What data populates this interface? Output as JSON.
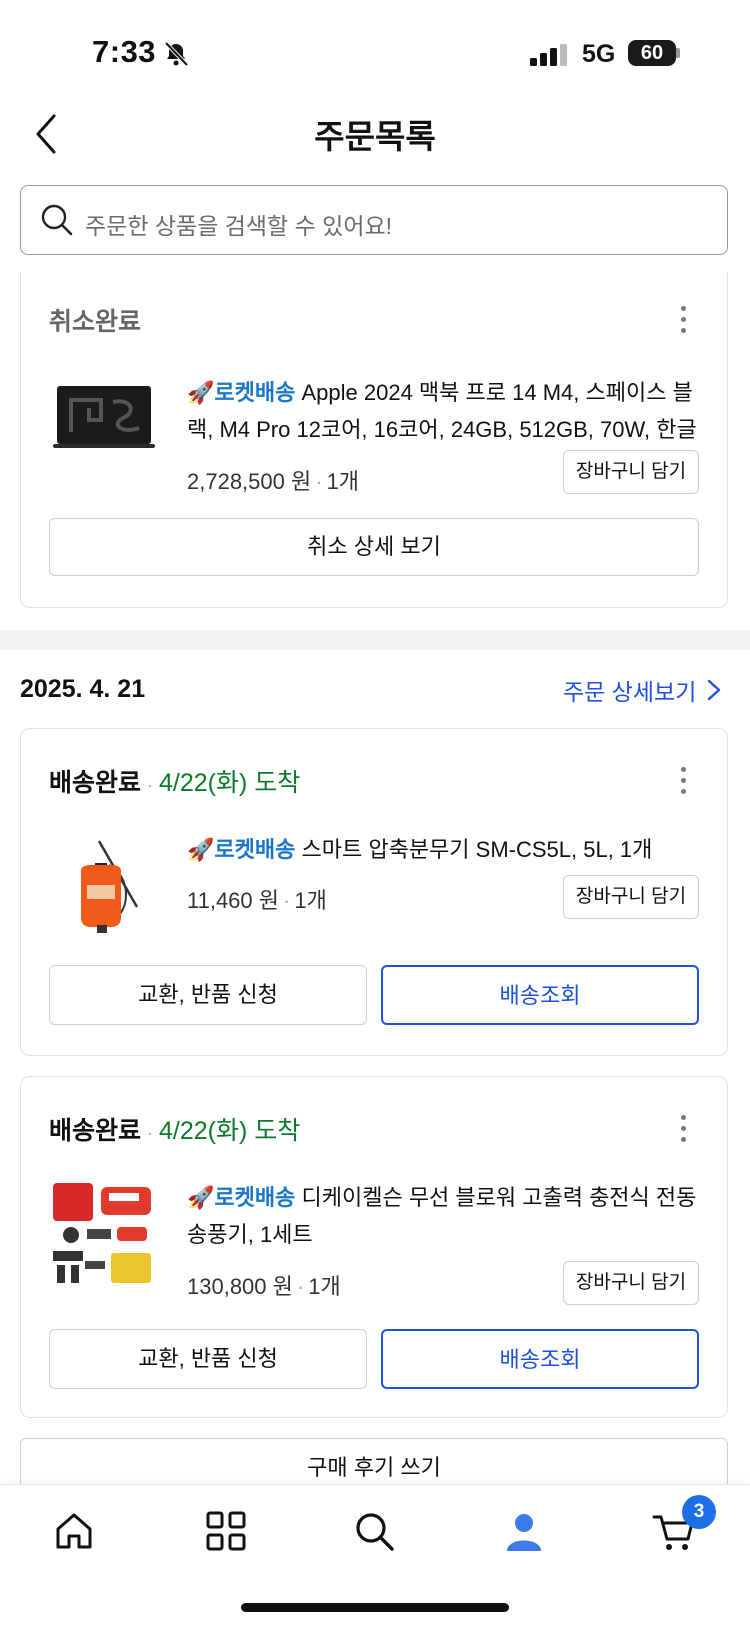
{
  "status_bar": {
    "time": "7:33",
    "network": "5G",
    "battery": "60"
  },
  "header": {
    "title": "주문목록"
  },
  "search": {
    "placeholder": "주문한 상품을 검색할 수 있어요!"
  },
  "cancelled_order": {
    "status": "취소완료",
    "product": {
      "badge": "로켓배송",
      "name": "Apple 2024 맥북 프로 14 M4, 스페이스 블랙, M4 Pro 12코어, 16코어, 24GB, 512GB, 70W, 한글",
      "price": "2,728,500 원",
      "quantity": "1개",
      "cart_label": "장바구니 담기"
    },
    "action_label": "취소 상세 보기"
  },
  "order_group": {
    "date": "2025. 4. 21",
    "detail_link": "주문 상세보기",
    "items": [
      {
        "status": "배송완료",
        "arrival": "4/22(화) 도착",
        "badge": "로켓배송",
        "name": "스마트 압축분무기 SM-CS5L, 5L, 1개",
        "price": "11,460 원",
        "quantity": "1개",
        "cart_label": "장바구니 담기",
        "exchange_label": "교환, 반품 신청",
        "track_label": "배송조회"
      },
      {
        "status": "배송완료",
        "arrival": "4/22(화) 도착",
        "badge": "로켓배송",
        "name": "디케이켈슨 무선 블로워 고출력 충전식 전동 송풍기, 1세트",
        "price": "130,800 원",
        "quantity": "1개",
        "cart_label": "장바구니 담기",
        "exchange_label": "교환, 반품 신청",
        "track_label": "배송조회"
      }
    ],
    "review_label": "구매 후기 쓰기"
  },
  "bottom_nav": {
    "items": [
      "home-icon",
      "category-grid-icon",
      "search-icon",
      "my-page-icon",
      "cart-icon"
    ],
    "cart_badge": "3",
    "active_color": "#3d7be8"
  },
  "colors": {
    "accent": "#1e4fe0",
    "arrival": "#0c7a2a",
    "rocket": "#1a77c8"
  }
}
